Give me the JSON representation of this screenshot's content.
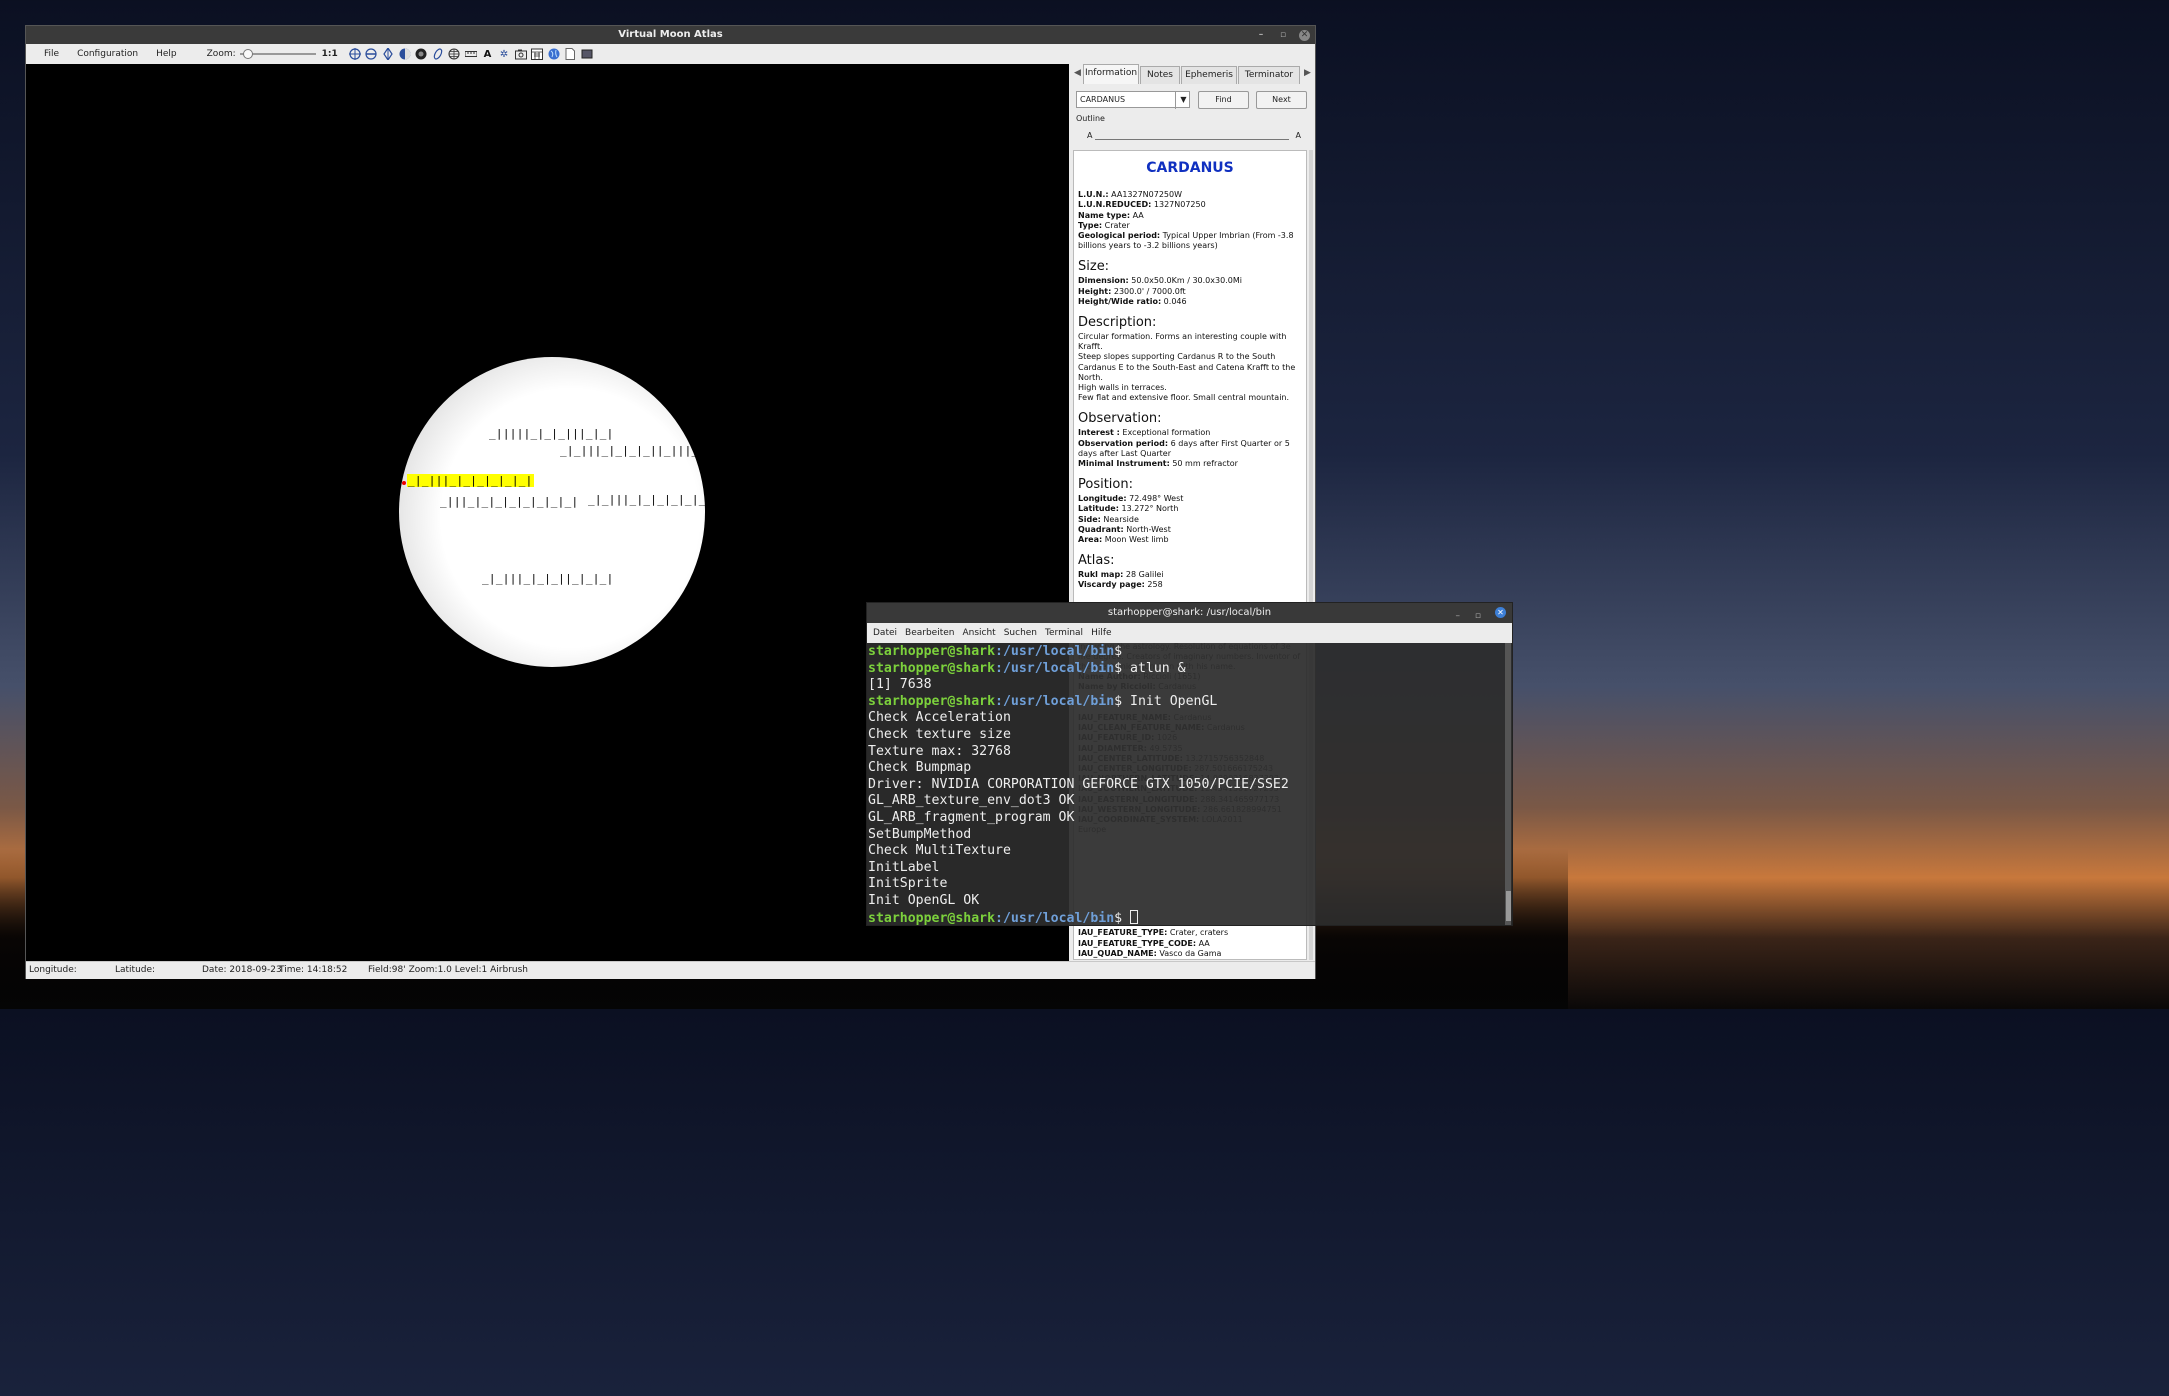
{
  "vma": {
    "title": "Virtual Moon Atlas",
    "window_buttons": [
      "–",
      "▫",
      "✕"
    ],
    "menu": [
      "File",
      "Configuration",
      "Help"
    ],
    "zoom_label": "Zoom:",
    "zoom_value": "1:1",
    "zoom_slider_level": 0.05,
    "toolbar_icons": [
      "crosshair-icon",
      "flip-horizontal-icon",
      "flip-vertical-icon",
      "phase-icon",
      "eyepiece-icon",
      "rotate-icon",
      "grid-icon",
      "ruler-icon",
      "label-icon",
      "settings-icon",
      "camera-icon",
      "calendar-icon",
      "globe-icon",
      "page-icon",
      "fullscreen-icon"
    ],
    "moon_labels": [
      "_|||||_|_|_|||_|_|",
      "_|_|||_|_|_|_||_|||_|||",
      "_|_|||_|_|_|_|_|_|",
      "_|||_|_|_|_|_|_|_|_|",
      "_|_|||_|_|_|_|_|_|||||_|_|||",
      "_|_|||_|_|_||_|_|_|"
    ],
    "status": {
      "longitude": "Longitude:",
      "latitude": "Latitude:",
      "date": "Date: 2018-09-23",
      "time": "Time: 14:18:52",
      "field": "Field:98' Zoom:1.0  Level:1 Airbrush"
    }
  },
  "panel": {
    "tabs": [
      "Information",
      "Notes",
      "Ephemeris",
      "Terminator"
    ],
    "active_tab": "Information",
    "search_value": "CARDANUS",
    "find_button": "Find",
    "next_button": "Next",
    "outline_label": "Outline",
    "outline_left": "A",
    "outline_right": "A",
    "feature_name": "CARDANUS",
    "identity": [
      {
        "k": "L.U.N.:",
        "v": " AA1327N07250W"
      },
      {
        "k": "L.U.N.REDUCED:",
        "v": " 1327N07250"
      },
      {
        "k": "Name type:",
        "v": " AA"
      },
      {
        "k": "Type:",
        "v": " Crater"
      },
      {
        "k": "Geological period:",
        "v": " Typical Upper Imbrian (From -3.8 billions years to -3.2 billions years)"
      }
    ],
    "size_heading": "Size:",
    "size": [
      {
        "k": "Dimension:",
        "v": " 50.0x50.0Km / 30.0x30.0Mi"
      },
      {
        "k": "Height:",
        "v": " 2300.0' / 7000.0ft"
      },
      {
        "k": "Height/Wide ratio:",
        "v": " 0.046"
      }
    ],
    "description_heading": "Description:",
    "description": [
      "Circular formation. Forms an interesting couple with Krafft.",
      "Steep slopes supporting Cardanus R to the South Cardanus E to the South-East and Catena Krafft to the North.",
      "High walls in terraces.",
      "Few flat and extensive floor. Small central mountain."
    ],
    "observation_heading": "Observation:",
    "observation": [
      {
        "k": "Interest :",
        "v": " Exceptional formation"
      },
      {
        "k": "Observation period:",
        "v": " 6 days after First Quarter or 5 days after Last Quarter"
      },
      {
        "k": "Minimal Instrument:",
        "v": " 50 mm refractor"
      }
    ],
    "position_heading": "Position:",
    "position": [
      {
        "k": "Longitude:",
        "v": " 72.498° West"
      },
      {
        "k": "Latitude:",
        "v": " 13.272° North"
      },
      {
        "k": "Side:",
        "v": " Nearside"
      },
      {
        "k": "Quadrant:",
        "v": " North-West"
      },
      {
        "k": "Area:",
        "v": " Moon West limb"
      }
    ],
    "atlas_heading": "Atlas:",
    "atlas": [
      {
        "k": "Rukl map:",
        "v": " 28 Galilei"
      },
      {
        "k": "Viscardy page:",
        "v": "  258"
      }
    ],
    "hidden_lines": [
      {
        "k": "",
        "v": "Cardano"
      },
      {
        "k": "",
        "v": "16 th century Italian Doctor, born in Italy"
      },
      {
        "k": "",
        "v": ""
      },
      {
        "k": "Important Facts:",
        "v": " Numerous philosophical works including the astrology. Resolution of equations of 3e me degree. Creators of imaginary numbers. Inventor of the mechanical junction with his name."
      },
      {
        "k": "Name Author:",
        "v": " Riccioli (1651)"
      },
      {
        "k": "Name by Riccioli:",
        "v": " Cardanus"
      },
      {
        "k": "",
        "v": ""
      },
      {
        "k": "",
        "v": ""
      },
      {
        "k": "IAU_FEATURE_NAME:",
        "v": " Cardanus"
      },
      {
        "k": "IAU_CLEAN_FEATURE_NAME:",
        "v": " Cardanus"
      },
      {
        "k": "IAU_FEATURE_ID:",
        "v": " 1026"
      },
      {
        "k": "IAU_DIAMETER:",
        "v": " 49.5735"
      },
      {
        "k": "IAU_CENTER_LATITUDE:",
        "v": " 13.2715756352848"
      },
      {
        "k": "IAU_CENTER_LONGITUDE:",
        "v": " 287.501666175243"
      },
      {
        "k": "IAU_NORTHERN_LATITUDE:",
        "v": " 14.0890216827393"
      },
      {
        "k": "IAU_SOUTHERN_LATITUDE:",
        "v": " 12.4541301727295"
      },
      {
        "k": "IAU_EASTERN_LONGITUDE:",
        "v": " 288.341465977173"
      },
      {
        "k": "IAU_WESTERN_LONGITUDE:",
        "v": " 286.661828994751"
      },
      {
        "k": "IAU_COORDINATE_SYSTEM:",
        "v": " LOLA2011"
      },
      {
        "k": "",
        "v": "Europe"
      },
      {
        "k": "",
        "v": ""
      }
    ],
    "bottom": [
      {
        "k": "IAU_FEATURE_TYPE:",
        "v": " Crater, craters"
      },
      {
        "k": "IAU_FEATURE_TYPE_CODE:",
        "v": " AA"
      },
      {
        "k": "IAU_QUAD_NAME:",
        "v": " Vasco da Gama"
      }
    ]
  },
  "terminal": {
    "title": "starhopper@shark: /usr/local/bin",
    "menu": [
      "Datei",
      "Bearbeiten",
      "Ansicht",
      "Suchen",
      "Terminal",
      "Hilfe"
    ],
    "prompt_user": "starhopper@shark",
    "prompt_path": ":/usr/local/bin",
    "lines": [
      {
        "prompt": true,
        "text": "$"
      },
      {
        "prompt": true,
        "text": "$ atlun &"
      },
      {
        "prompt": false,
        "text": "[1] 7638"
      },
      {
        "prompt": true,
        "text": "$ Init OpenGL"
      },
      {
        "prompt": false,
        "text": "Check Acceleration"
      },
      {
        "prompt": false,
        "text": "Check texture size"
      },
      {
        "prompt": false,
        "text": "Texture max: 32768"
      },
      {
        "prompt": false,
        "text": "Check Bumpmap"
      },
      {
        "prompt": false,
        "text": "Driver: NVIDIA CORPORATION GEFORCE GTX 1050/PCIE/SSE2"
      },
      {
        "prompt": false,
        "text": "GL_ARB_texture_env_dot3 OK"
      },
      {
        "prompt": false,
        "text": "GL_ARB_fragment_program OK"
      },
      {
        "prompt": false,
        "text": "SetBumpMethod"
      },
      {
        "prompt": false,
        "text": "Check MultiTexture"
      },
      {
        "prompt": false,
        "text": "InitLabel"
      },
      {
        "prompt": false,
        "text": "InitSprite"
      },
      {
        "prompt": false,
        "text": "Init OpenGL OK"
      },
      {
        "prompt": true,
        "text": "$ ",
        "cursor": true
      }
    ]
  }
}
